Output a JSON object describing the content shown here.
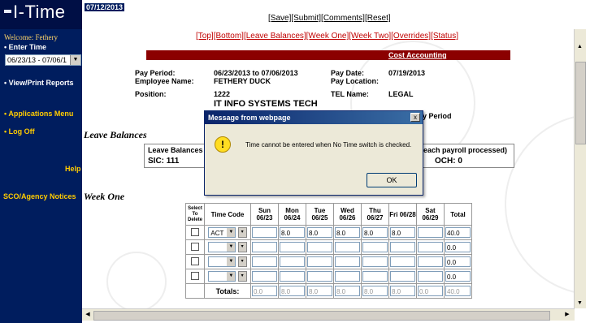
{
  "app": {
    "logo_text": "I-Time",
    "date": "07/12/2013"
  },
  "top_nav": {
    "save": "[Save]",
    "submit": "[Submit]",
    "comments": "[Comments]",
    "reset": "[Reset]"
  },
  "section_nav": {
    "top": "[Top]",
    "bottom": "[Bottom]",
    "leave_balances": "[Leave Balances]",
    "week_one": "[Week One]",
    "week_two": "[Week Two]",
    "overrides": "[Overrides]",
    "status": "[Status]"
  },
  "sidebar": {
    "welcome": "Welcome: Fethery",
    "enter_time": "• Enter Time",
    "period_value": "06/23/13 - 07/06/1",
    "view_print": "• View/Print Reports",
    "apps_menu": "• Applications Menu",
    "log_off": "• Log Off",
    "help": "Help",
    "sco": "SCO/Agency Notices"
  },
  "header": {
    "cost_accounting": "Cost Accounting",
    "pay_period_label": "Pay Period:",
    "pay_period_value": "06/23/2013 to 07/06/2013",
    "employee_name_label": "Employee Name:",
    "employee_name_value": "FETHERY DUCK",
    "pay_date_label": "Pay Date:",
    "pay_date_value": "07/19/2013",
    "pay_location_label": "Pay Location:",
    "position_label": "Position:",
    "position_code": "1222",
    "position_title": "IT INFO SYSTEMS TECH",
    "tel_name_label": "TEL Name:",
    "tel_name_value": "LEGAL",
    "period_fragment": "y Period"
  },
  "leave": {
    "title": "Leave Balances",
    "box_header_left": "Leave Balances a",
    "box_header_right": "each payroll processed)",
    "sic_label": "SIC:",
    "sic_value": "111",
    "och_label": "OCH:",
    "och_value": "0"
  },
  "week_one": {
    "title": "Week One",
    "headers": {
      "select": "Select To Delete",
      "time_code": "Time Code",
      "sun": "Sun 06/23",
      "mon": "Mon 06/24",
      "tue": "Tue 06/25",
      "wed": "Wed 06/26",
      "thu": "Thu 06/27",
      "fri": "Fri 06/28",
      "sat": "Sat 06/29",
      "total": "Total"
    },
    "rows": [
      {
        "code": "ACT",
        "sun": "",
        "mon": "8.0",
        "tue": "8.0",
        "wed": "8.0",
        "thu": "8.0",
        "fri": "8.0",
        "sat": "",
        "total": "40.0"
      },
      {
        "code": "",
        "sun": "",
        "mon": "",
        "tue": "",
        "wed": "",
        "thu": "",
        "fri": "",
        "sat": "",
        "total": "0.0"
      },
      {
        "code": "",
        "sun": "",
        "mon": "",
        "tue": "",
        "wed": "",
        "thu": "",
        "fri": "",
        "sat": "",
        "total": "0.0"
      },
      {
        "code": "",
        "sun": "",
        "mon": "",
        "tue": "",
        "wed": "",
        "thu": "",
        "fri": "",
        "sat": "",
        "total": "0.0"
      }
    ],
    "totals": {
      "label": "Totals:",
      "sun": "0.0",
      "mon": "8.0",
      "tue": "8.0",
      "wed": "8.0",
      "thu": "8.0",
      "fri": "8.0",
      "sat": "0.0",
      "total": "40.0"
    }
  },
  "dialog": {
    "title": "Message from webpage",
    "close": "x",
    "icon": "!",
    "message": "Time cannot be entered when No Time switch is checked.",
    "ok": "OK"
  },
  "icons": {
    "warning": "warning-icon",
    "dropdown": "chevron-down-icon"
  },
  "colors": {
    "sidebar_bg": "#001d5e",
    "link_red": "#c00000",
    "cost_bar": "#8b0000",
    "nav_yellow": "#ffcc00"
  }
}
